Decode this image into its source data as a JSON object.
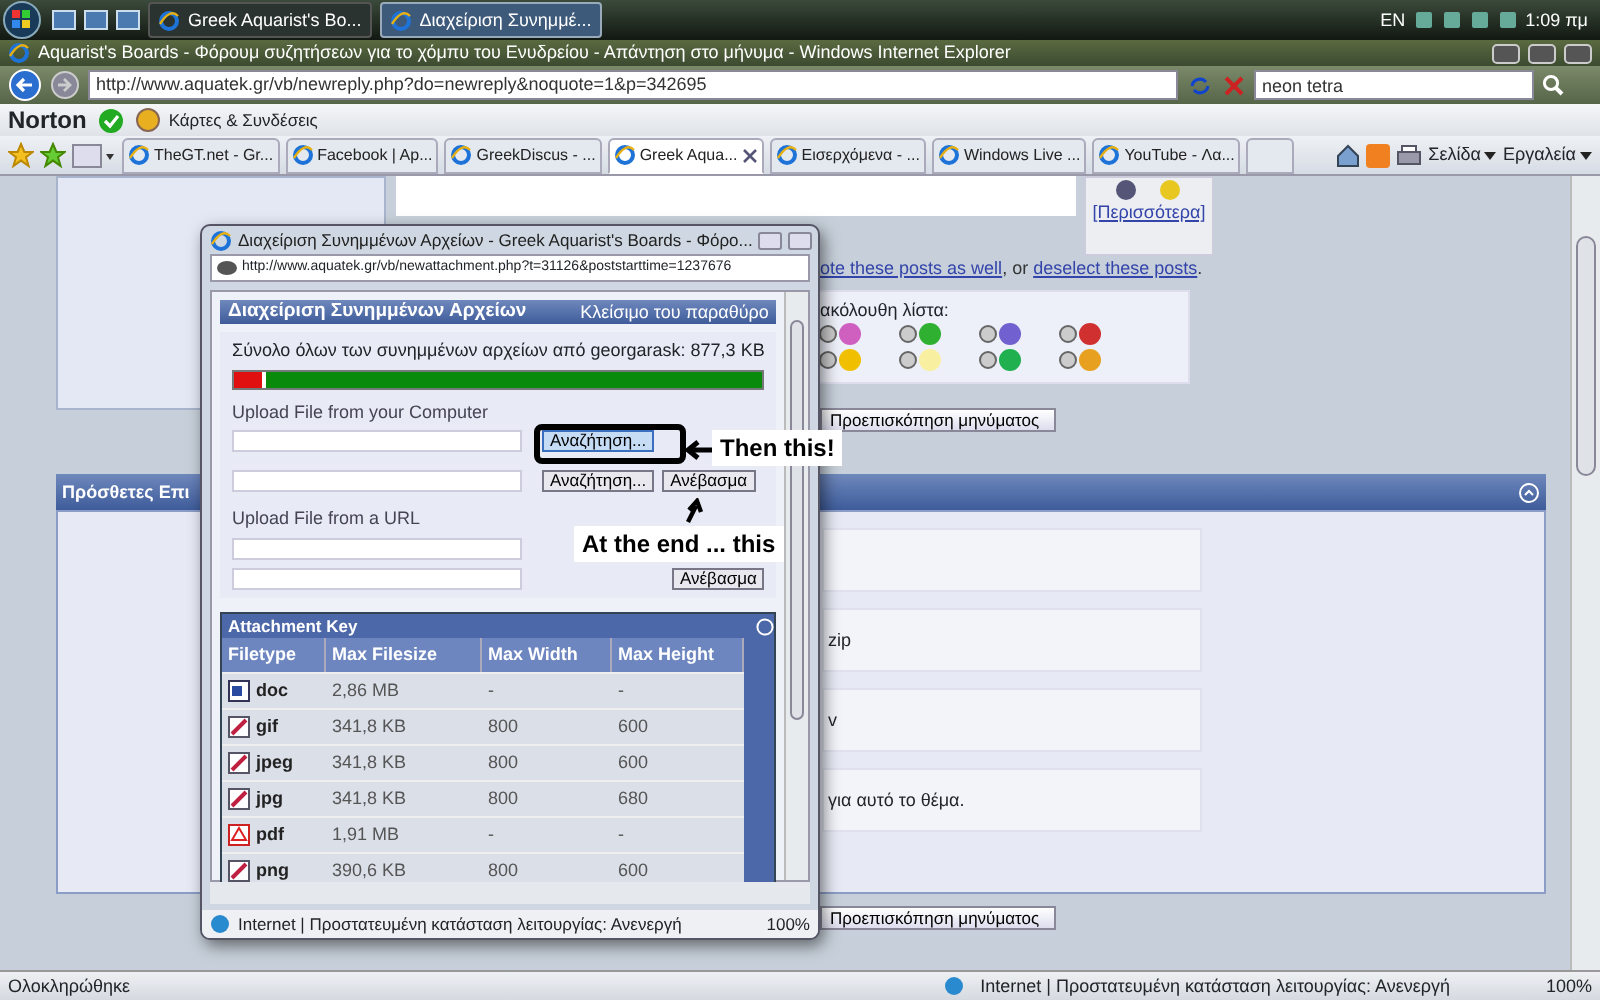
{
  "taskbar": {
    "tasks": [
      {
        "label": "Greek Aquarist's Bo...",
        "selected": false
      },
      {
        "label": "Διαχείριση Συνημμέ...",
        "selected": true
      }
    ],
    "language": "EN",
    "clock": "1:09 πμ"
  },
  "browser": {
    "title": "Aquarist's Boards - Φόρουμ συζητήσεων για το χόμπυ του Ενυδρείου - Απάντηση στο μήνυμα - Windows Internet Explorer",
    "address": "http://www.aquatek.gr/vb/newreply.php?do=newreply&noquote=1&p=342695",
    "search_value": "neon tetra",
    "toolbar_brand": "Norton",
    "toolbar_link": "Κάρτες & Συνδέσεις",
    "tabs": [
      {
        "label": "TheGT.net - Gr...",
        "selected": false
      },
      {
        "label": "Facebook | Ap...",
        "selected": false
      },
      {
        "label": "GreekDiscus - ...",
        "selected": false
      },
      {
        "label": "Greek Aqua...",
        "selected": true
      },
      {
        "label": "Εισερχόμενα - ...",
        "selected": false
      },
      {
        "label": "Windows Live ...",
        "selected": false
      },
      {
        "label": "YouTube - Λα...",
        "selected": false
      }
    ],
    "commands": [
      "Σελίδα",
      "Εργαλεία"
    ]
  },
  "page": {
    "more_link": "[Περισσότερα]",
    "quote_note": [
      {
        "kind": "link",
        "text": "ote these posts as well"
      },
      {
        "kind": "text",
        "text": ", or "
      },
      {
        "kind": "link",
        "text": "deselect these posts"
      },
      {
        "kind": "text",
        "text": "."
      }
    ],
    "icons_label": "ακόλουθη λίστα:",
    "preview_button": "Προεπισκόπηση μηνύματος",
    "options_panel": {
      "title": "Πρόσθετες Επι",
      "rows": [
        "zip",
        "v",
        "για αυτό το θέμα."
      ],
      "preview_button": "Προεπισκόπηση μηνύματος"
    }
  },
  "popup": {
    "title": "Διαχείριση Συνημμένων Αρχείων - Greek Aquarist's Boards - Φόρο...",
    "address": "http://www.aquatek.gr/vb/newattachment.php?t=31126&poststarttime=1237676",
    "heading": "Διαχείριση Συνημμένων Αρχείων",
    "close_link": "Κλείσιμο του παραθύρο",
    "usage": {
      "text": "Σύνολο όλων των συνημμένων αρχείων από georgarask: 877,3 KB",
      "level": 0.06
    },
    "upload_computer": {
      "label": "Upload File from your Computer",
      "browse_buttons": [
        {
          "label": "Αναζήτηση...",
          "focused": true
        },
        {
          "label": "Αναζήτηση...",
          "focused": false
        }
      ],
      "upload_button": "Ανέβασμα"
    },
    "upload_url": {
      "label": "Upload File from a URL",
      "upload_button": "Ανέβασμα"
    },
    "attachment_key": {
      "title": "Attachment Key",
      "columns": [
        "Filetype",
        "Max Filesize",
        "Max Width",
        "Max Height"
      ],
      "rows": [
        {
          "kind": "document",
          "cells": [
            "doc",
            "2,86 MB",
            "-",
            "-"
          ]
        },
        {
          "kind": "image",
          "cells": [
            "gif",
            "341,8 KB",
            "800",
            "600"
          ]
        },
        {
          "kind": "image",
          "cells": [
            "jpeg",
            "341,8 KB",
            "800",
            "600"
          ]
        },
        {
          "kind": "image",
          "cells": [
            "jpg",
            "341,8 KB",
            "800",
            "680"
          ]
        },
        {
          "kind": "pdf",
          "cells": [
            "pdf",
            "1,91 MB",
            "-",
            "-"
          ]
        },
        {
          "kind": "image",
          "cells": [
            "png",
            "390,6 KB",
            "800",
            "600"
          ]
        }
      ]
    },
    "status": {
      "zone": "Internet | Προστατευμένη κατάσταση λειτουργίας: Ανενεργή",
      "zoom": "100%"
    }
  },
  "annotations": [
    {
      "text": "Then this!"
    },
    {
      "text": "At the end ... this"
    }
  ],
  "status_bar": {
    "text": "Ολοκληρώθηκε",
    "zone": "Internet | Προστατευμένη κατάσταση λειτουργίας: Ανενεργή",
    "zoom": "100%"
  }
}
